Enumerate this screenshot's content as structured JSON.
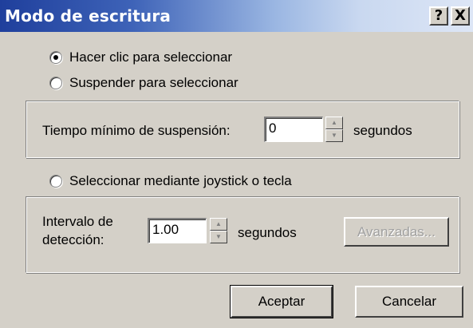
{
  "window": {
    "title": "Modo de escritura",
    "help_glyph": "?",
    "close_glyph": "X"
  },
  "modes": {
    "click": {
      "label": "Hacer clic para seleccionar",
      "selected": true
    },
    "hover": {
      "label": "Suspender para seleccionar",
      "selected": false
    },
    "joystick": {
      "label": "Seleccionar mediante joystick o tecla",
      "selected": false
    }
  },
  "hover_group": {
    "label": "Tiempo mínimo de suspensión:",
    "value": "0",
    "units": "segundos"
  },
  "scan_group": {
    "label_line1": "Intervalo de",
    "label_line2": "detección:",
    "value": "1.00",
    "units": "segundos",
    "advanced_label": "Avanzadas..."
  },
  "buttons": {
    "ok_label": "Aceptar",
    "cancel_label": "Cancelar"
  },
  "icons": {
    "spin_up": "▲",
    "spin_down": "▼"
  }
}
